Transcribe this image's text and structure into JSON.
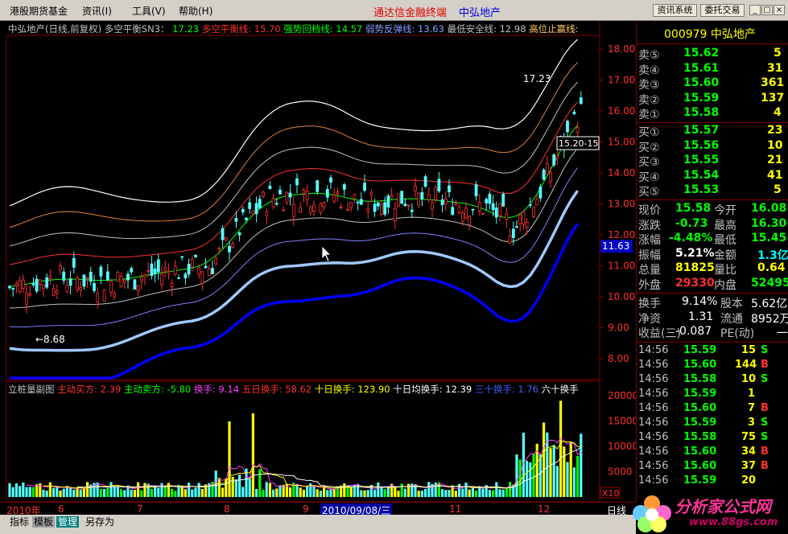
{
  "menu": {
    "items": [
      "港股期货基金",
      "资讯(I)",
      "工具(V)",
      "帮助(H)"
    ],
    "center_title": "通达信金融终端",
    "center_stock": "中弘地产",
    "buttons": [
      "资讯系统",
      "委托交易"
    ]
  },
  "indicator_line": {
    "name": "中弘地产(日线,前复权)",
    "indicator": "多空平衡SN3：",
    "values": [
      {
        "label": "17.23",
        "color": "#00ff00"
      },
      {
        "label": "多空平衡线: 15.70",
        "color": "#ff3030"
      },
      {
        "label": "强势回档线: 14.57",
        "color": "#00ff00"
      },
      {
        "label": "弱势反弹线: 13.63",
        "color": "#80a0ff"
      },
      {
        "label": "最低安全线: 12.98",
        "color": "#c0c0c0"
      },
      {
        "label": "高位止赢线:",
        "color": "#ffcc66"
      }
    ]
  },
  "sub_indicator_line": {
    "name": "立桩量副图",
    "values": [
      {
        "label": "主动买方: 2.39",
        "color": "#ff3030"
      },
      {
        "label": "主动卖方: -5.80",
        "color": "#00ff00"
      },
      {
        "label": "换手: 9.14",
        "color": "#ff40ff"
      },
      {
        "label": "五日换手: 58.62",
        "color": "#ff3030"
      },
      {
        "label": "十日换手: 123.90",
        "color": "#ffff00"
      },
      {
        "label": "十日均换手: 12.39",
        "color": "#ffffff"
      },
      {
        "label": "三十换手: 1.76",
        "color": "#4060ff"
      },
      {
        "label": "六十换手",
        "color": "#ffffff"
      }
    ]
  },
  "price_axis": [
    "18.00",
    "17.00",
    "16.00",
    "15.00",
    "14.00",
    "13.00",
    "12.00",
    "11.00",
    "10.00",
    "9.00",
    "8.00"
  ],
  "current_price_marker": "11.63",
  "volume_axis": [
    "20000",
    "15000",
    "10000",
    "5000",
    "X10"
  ],
  "annotations": {
    "high": "17.23",
    "low": "8.68",
    "tooltip": "15.20-15"
  },
  "date_axis": [
    "2010年",
    "6",
    "7",
    "8",
    "9",
    "2010/09/08/三",
    "11",
    "12",
    "日线"
  ],
  "bottom_tabs": [
    "指标",
    "模板",
    "管理",
    "另存为"
  ],
  "quote": {
    "code": "000979",
    "name": "中弘地产",
    "asks": [
      {
        "label": "卖⑤",
        "price": "15.62",
        "vol": "5"
      },
      {
        "label": "卖④",
        "price": "15.61",
        "vol": "31"
      },
      {
        "label": "卖③",
        "price": "15.60",
        "vol": "361"
      },
      {
        "label": "卖②",
        "price": "15.59",
        "vol": "137"
      },
      {
        "label": "卖①",
        "price": "15.58",
        "vol": "4"
      }
    ],
    "bids": [
      {
        "label": "买①",
        "price": "15.57",
        "vol": "23"
      },
      {
        "label": "买②",
        "price": "15.56",
        "vol": "10"
      },
      {
        "label": "买③",
        "price": "15.55",
        "vol": "21"
      },
      {
        "label": "买④",
        "price": "15.54",
        "vol": "41"
      },
      {
        "label": "买⑤",
        "price": "15.53",
        "vol": "5"
      }
    ],
    "stats": [
      {
        "l1": "现价",
        "v1": "15.58",
        "c1": "#00ff00",
        "l2": "今开",
        "v2": "16.08",
        "c2": "#00ff00"
      },
      {
        "l1": "涨跌",
        "v1": "-0.73",
        "c1": "#00ff00",
        "l2": "最高",
        "v2": "16.30",
        "c2": "#00ff00"
      },
      {
        "l1": "涨幅",
        "v1": "-4.48%",
        "c1": "#00ff00",
        "l2": "最低",
        "v2": "15.45",
        "c2": "#00ff00"
      },
      {
        "l1": "振幅",
        "v1": "5.21%",
        "c1": "#ffffff",
        "l2": "金额",
        "v2": "1.3亿",
        "c2": "#00ffff"
      },
      {
        "l1": "总量",
        "v1": "81825",
        "c1": "#ffff00",
        "l2": "量比",
        "v2": "0.64",
        "c2": "#ffff00"
      },
      {
        "l1": "外盘",
        "v1": "29330",
        "c1": "#ff3030",
        "l2": "内盘",
        "v2": "52495",
        "c2": "#00ff00"
      }
    ],
    "stats2": [
      {
        "l1": "换手",
        "v1": "9.14%",
        "l2": "股本",
        "v2": "5.62亿"
      },
      {
        "l1": "净资",
        "v1": "1.31",
        "l2": "流通",
        "v2": "8952万"
      },
      {
        "l1": "收益(三)",
        "v1": "-0.087",
        "l2": "PE(动)",
        "v2": "一"
      }
    ],
    "ticks": [
      {
        "time": "14:56",
        "price": "15.59",
        "vol": "15",
        "side": "S"
      },
      {
        "time": "14:56",
        "price": "15.60",
        "vol": "144",
        "side": "B"
      },
      {
        "time": "14:56",
        "price": "15.58",
        "vol": "10",
        "side": "S"
      },
      {
        "time": "14:56",
        "price": "15.59",
        "vol": "1",
        "side": ""
      },
      {
        "time": "14:56",
        "price": "15.60",
        "vol": "7",
        "side": "B"
      },
      {
        "time": "14:56",
        "price": "15.59",
        "vol": "3",
        "side": "S"
      },
      {
        "time": "14:56",
        "price": "15.58",
        "vol": "75",
        "side": "S"
      },
      {
        "time": "14:56",
        "price": "15.60",
        "vol": "34",
        "side": "B"
      },
      {
        "time": "14:56",
        "price": "15.60",
        "vol": "37",
        "side": "B"
      },
      {
        "time": "14:56",
        "price": "15.59",
        "vol": "20",
        "side": ""
      }
    ]
  },
  "watermark": {
    "text": "分析家公式网",
    "url": "www.88gs.com"
  },
  "colors": {
    "up": "#ff3030",
    "down": "#54ffff",
    "panel_border": "#800000",
    "menu_bg": "#d4d0c8"
  }
}
